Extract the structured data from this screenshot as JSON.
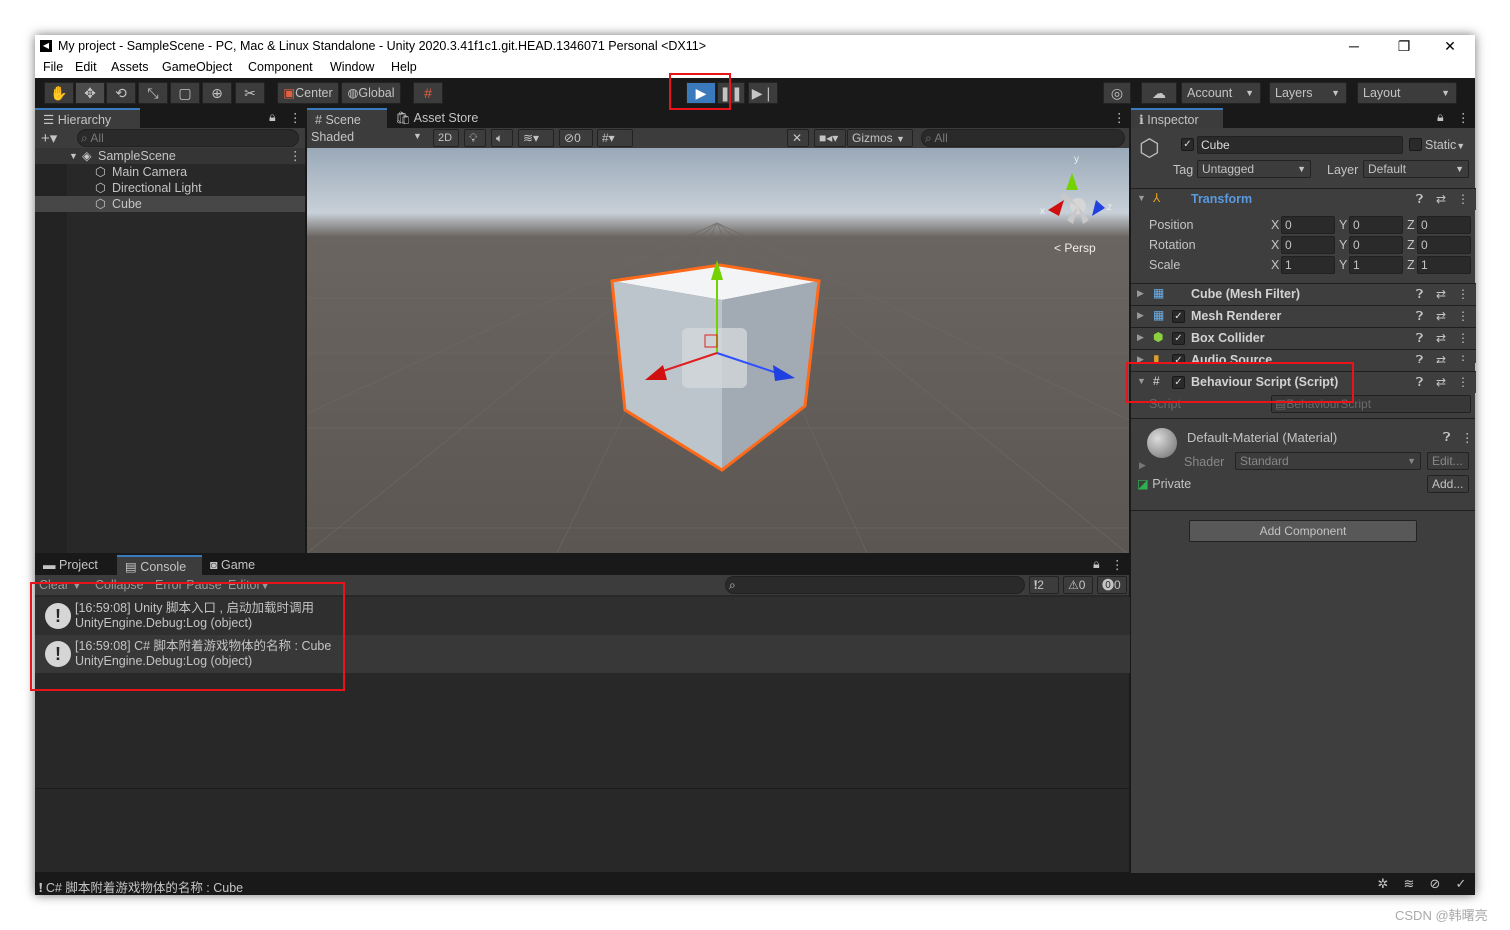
{
  "window": {
    "title": "My project - SampleScene - PC, Mac & Linux Standalone - Unity 2020.3.41f1c1.git.HEAD.1346071 Personal <DX11>",
    "controls": {
      "minimize": "─",
      "restore": "❐",
      "close": "✕"
    }
  },
  "menu": [
    "File",
    "Edit",
    "Assets",
    "GameObject",
    "Component",
    "Window",
    "Help"
  ],
  "toolbar": {
    "tools": [
      "hand-icon",
      "move-icon",
      "rotate-icon",
      "scale-icon",
      "rect-icon",
      "transform-icon",
      "custom-tool-icon"
    ],
    "pivot": "Center",
    "space": "Global",
    "account": "Account",
    "layers": "Layers",
    "layout": "Layout"
  },
  "hierarchy": {
    "tab": "Hierarchy",
    "search_placeholder": "All",
    "scene": "SampleScene",
    "items": [
      "Main Camera",
      "Directional Light",
      "Cube"
    ]
  },
  "scene_view": {
    "tabs": [
      "Scene",
      "Asset Store"
    ],
    "shading": "Shaded",
    "mode_2d": "2D",
    "hidden_count": "0",
    "gizmos": "Gizmos",
    "search_placeholder": "All",
    "axis_labels": {
      "y": "y",
      "x": "x",
      "z": "z"
    },
    "projection": "Persp"
  },
  "inspector": {
    "tab": "Inspector",
    "object_name": "Cube",
    "static_label": "Static",
    "tag_label": "Tag",
    "tag": "Untagged",
    "layer_label": "Layer",
    "layer": "Default",
    "transform": {
      "title": "Transform",
      "rows": [
        {
          "label": "Position",
          "x": "0",
          "y": "0",
          "z": "0"
        },
        {
          "label": "Rotation",
          "x": "0",
          "y": "0",
          "z": "0"
        },
        {
          "label": "Scale",
          "x": "1",
          "y": "1",
          "z": "1"
        }
      ]
    },
    "components": [
      "Cube (Mesh Filter)",
      "Mesh Renderer",
      "Box Collider",
      "Audio Source",
      "Behaviour Script (Script)"
    ],
    "script_label": "Script",
    "script_value": "BehaviourScript",
    "material": {
      "title": "Default-Material (Material)",
      "shader_label": "Shader",
      "shader": "Standard",
      "edit": "Edit...",
      "private": "Private",
      "add": "Add..."
    },
    "add_component": "Add Component"
  },
  "bottom": {
    "tabs": [
      "Project",
      "Console",
      "Game"
    ],
    "console_buttons": [
      "Clear",
      "Collapse",
      "Error Pause",
      "Editor"
    ],
    "counts": {
      "log": "2",
      "warn": "0",
      "error": "0"
    },
    "logs": [
      {
        "line1": "[16:59:08] Unity 脚本入口 , 启动加载时调用",
        "line2": "UnityEngine.Debug:Log (object)"
      },
      {
        "line1": "[16:59:08] C# 脚本附着游戏物体的名称 : Cube",
        "line2": "UnityEngine.Debug:Log (object)"
      }
    ]
  },
  "status": {
    "message": "C# 脚本附着游戏物体的名称 : Cube"
  },
  "watermark": "CSDN @韩曙亮"
}
